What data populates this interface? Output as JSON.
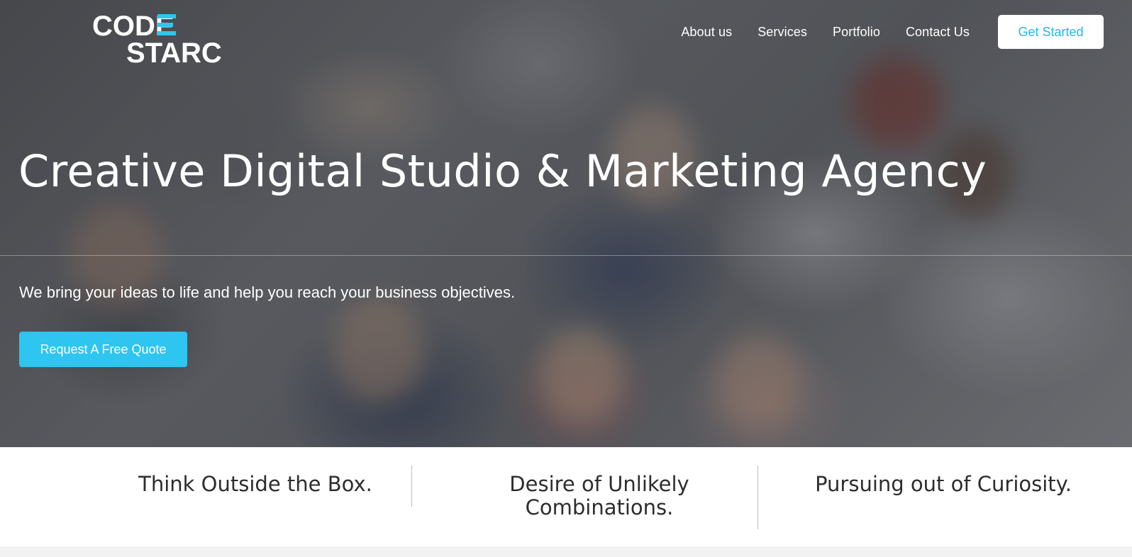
{
  "brand": {
    "logo_line1": "CODE",
    "logo_line2": "STARC",
    "accent_color": "#2ec5f0"
  },
  "nav": {
    "items": [
      "About us",
      "Services",
      "Portfolio",
      "Contact Us"
    ],
    "cta_label": "Get Started"
  },
  "hero": {
    "headline": "Creative Digital Studio & Marketing Agency",
    "subline": "We bring your ideas to life and help you reach your business objectives.",
    "cta_label": "Request A Free Quote"
  },
  "features": [
    "Think Outside the Box.",
    "Desire of Unlikely Combinations.",
    "Pursuing out of Curiosity."
  ]
}
